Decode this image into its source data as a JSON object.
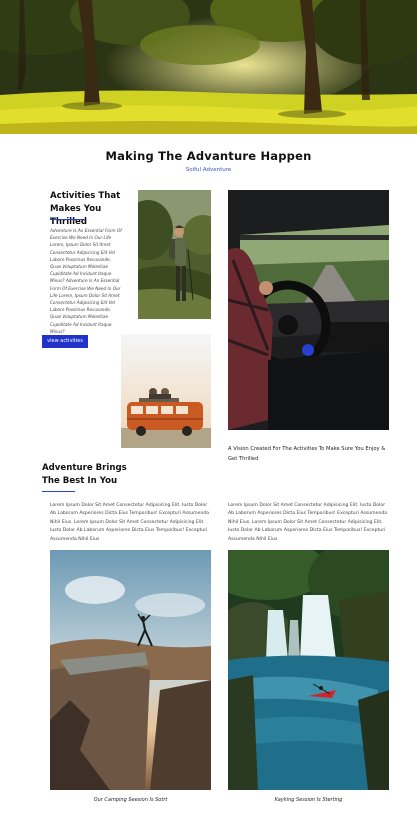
{
  "header": {
    "title": "Making The Advanture Happen",
    "subtitle": "Soiful Adventure"
  },
  "activities": {
    "heading_line1": "Activities That",
    "heading_line2": "Makes You Thrilled",
    "description": "Adventure Is An Essential Form Of Exercise We Need In Our Life Lorem, Ipsum Dolor Sit Amet Consectetur Adipisicing Elit Vel Labore Possimus Recusande, Quae Voluptatum Molestiae Cupiditate Ad Incidunt Itaque Minus? Adventure Is An Essential Form Of Exercise We Need In Our Life Lorem, Ipsum Dolor Sit Amet Consectetur Adipisicing Elit Vel Labore Possimus Recusande, Quae Voluptatum Molestiae Cupiditate Ad Incidunt Itaque Minus?",
    "button_label": "view activities"
  },
  "vision": {
    "text": "A Vision Created For The Activities To Make Sure You Enjoy & Get Thrilled"
  },
  "brings": {
    "heading_line1": "Adventure Brings",
    "heading_line2": "The Best In You"
  },
  "columns": [
    {
      "text": "Lorem Ipsum Dolor Sit Amet Consectetur Adipisicing Elit. Iusto Dolor Ab Laborum Asperiores Dicta Eius Temporibus! Excepturi Assumenda Nihil Eius. Lorem Ipsum Dolor Sit Amet Consectetur Adipisicing Elit. Iusto Dolor Ab Laborum Asperiores Dicta Eius Temporibus! Excepturi Assumenda Nihil Eius",
      "caption": "Our Camping Seesion Is Sotrt"
    },
    {
      "text": "Lorem Ipsum Dolor Sit Amet Consectetur Adipisicing Elit. Iusto Dolor Ab Laborum Asperiores Dicta Eius Temporibus! Excepturi Assumenda Nihil Eius. Lorem Ipsum Dolor Sit Amet Consectetur Adipisicing Elit. Iusto Dolor Ab Laborum Asperiores Dicta Eius Temporibus! Excepturi Assumenda Nihil Eius",
      "caption": "Kayking Session Is Sterting"
    }
  ],
  "colors": {
    "accent": "#2233cc",
    "subtitle": "#3553c8"
  }
}
